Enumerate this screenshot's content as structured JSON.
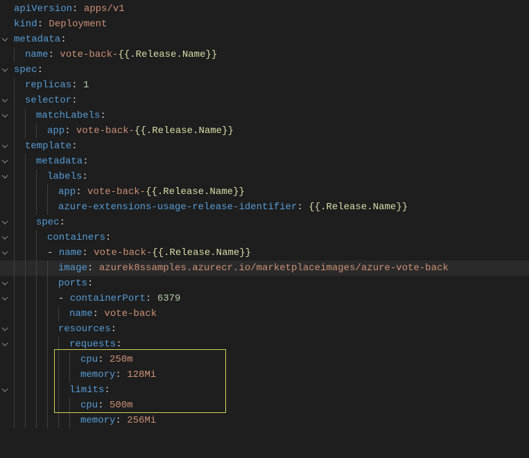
{
  "keys": {
    "apiVersion": "apiVersion",
    "kind": "kind",
    "metadata": "metadata",
    "name": "name",
    "spec": "spec",
    "replicas": "replicas",
    "selector": "selector",
    "matchLabels": "matchLabels",
    "app": "app",
    "template": "template",
    "labels": "labels",
    "azureExt": "azure-extensions-usage-release-identifier",
    "containers": "containers",
    "image": "image",
    "ports": "ports",
    "containerPort": "containerPort",
    "resources": "resources",
    "requests": "requests",
    "cpu": "cpu",
    "memory": "memory",
    "limits": "limits"
  },
  "values": {
    "apiVersion": "apps/v1",
    "kind": "Deployment",
    "voteBackPrefix": "vote-back-",
    "releaseName": ".Release.Name",
    "replicas": "1",
    "containerPort": "6379",
    "portName": "vote-back",
    "image": "azurek8ssamples.azurecr.io/marketplaceimages/azure-vote-back",
    "cpuRequest": "250m",
    "memRequest": "128Mi",
    "cpuLimit": "500m",
    "memLimit": "256Mi"
  },
  "punct": {
    "colon": ":",
    "colonSpace": ": ",
    "dashSpace": "- ",
    "open": "{{",
    "close": "}}"
  }
}
